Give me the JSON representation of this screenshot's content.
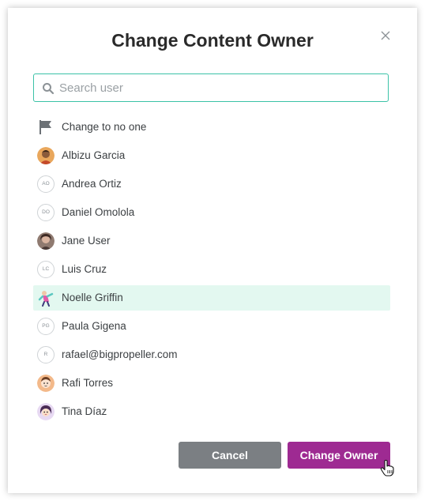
{
  "dialog": {
    "title": "Change Content Owner",
    "close_icon": "close-icon"
  },
  "search": {
    "placeholder": "Search user",
    "value": "",
    "icon": "search-icon"
  },
  "users": [
    {
      "name": "Change to no one",
      "avatar": "flag-icon"
    },
    {
      "name": "Albizu Garcia",
      "avatar": "photo"
    },
    {
      "name": "Andrea Ortiz",
      "initials": "AO"
    },
    {
      "name": "Daniel Omolola",
      "initials": "DO"
    },
    {
      "name": "Jane User",
      "avatar": "photo"
    },
    {
      "name": "Luis Cruz",
      "initials": "LC"
    },
    {
      "name": "Noelle Griffin",
      "avatar": "illustration",
      "selected": true
    },
    {
      "name": "Paula Gigena",
      "initials": "PG"
    },
    {
      "name": "rafael@bigpropeller.com",
      "initials": "R"
    },
    {
      "name": "Rafi Torres",
      "avatar": "illustration"
    },
    {
      "name": "Tina Díaz",
      "avatar": "illustration"
    }
  ],
  "buttons": {
    "cancel": "Cancel",
    "confirm": "Change Owner"
  },
  "colors": {
    "accent": "#3cc2a7",
    "selected_row": "#e3f8f0",
    "primary_button": "#9e2a92",
    "cancel_button": "#7b7f83"
  }
}
